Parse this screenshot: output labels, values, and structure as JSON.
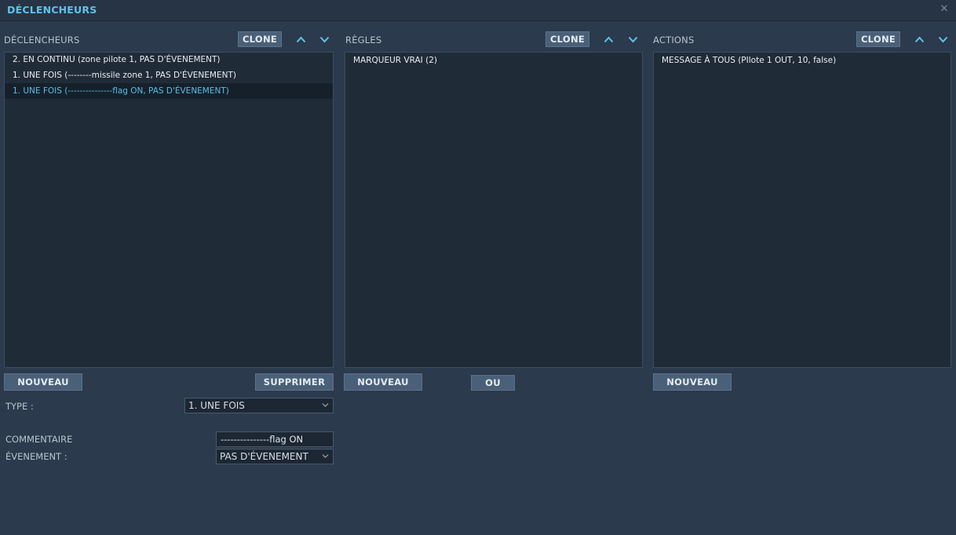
{
  "window": {
    "title": "DÉCLENCHEURS",
    "close_glyph": "✕"
  },
  "colors": {
    "accent": "#5fc3ea",
    "background": "#2b3a4c",
    "list_bg": "#202b38",
    "button_bg": "#4a6078"
  },
  "triggers": {
    "label": "DÉCLENCHEURS",
    "clone_label": "CLONE",
    "items": [
      {
        "text": "2. EN CONTINU (zone pilote 1, PAS D'ÉVENEMENT)"
      },
      {
        "text": "1. UNE FOIS (--------missile zone 1, PAS D'ÉVENEMENT)"
      },
      {
        "text": "1. UNE FOIS (---------------flag ON, PAS D'ÉVENEMENT)"
      }
    ],
    "new_label": "NOUVEAU",
    "delete_label": "SUPPRIMER"
  },
  "rules": {
    "label": "RÈGLES",
    "clone_label": "CLONE",
    "items": [
      {
        "text": "MARQUEUR VRAI (2)"
      }
    ],
    "new_label": "NOUVEAU",
    "or_label": "OU"
  },
  "actions": {
    "label": "ACTIONS",
    "clone_label": "CLONE",
    "items": [
      {
        "text": "MESSAGE À TOUS (PIlote 1 OUT, 10, false)"
      }
    ],
    "new_label": "NOUVEAU"
  },
  "form": {
    "type_label": "TYPE :",
    "type_value": "1. UNE FOIS",
    "comment_label": "COMMENTAIRE",
    "comment_value": "---------------flag ON",
    "event_label": "ÉVENEMENT :",
    "event_value": "PAS D'ÉVENEMENT"
  }
}
